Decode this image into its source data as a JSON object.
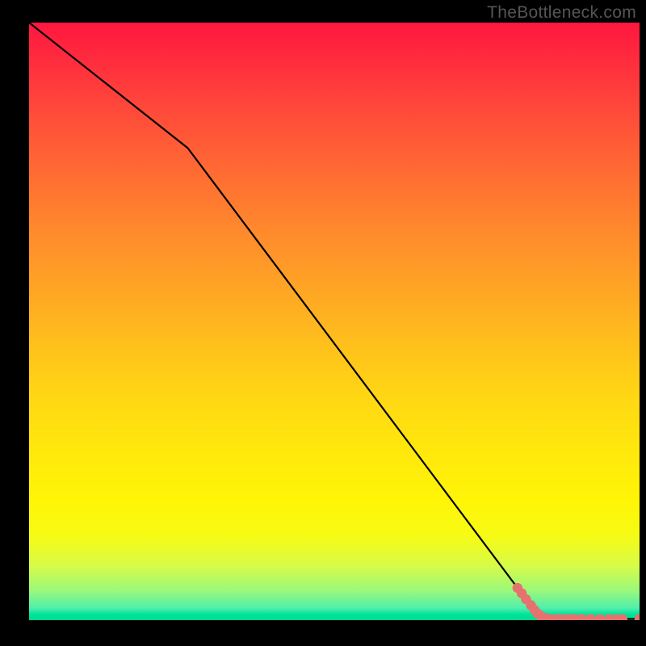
{
  "watermark": "TheBottleneck.com",
  "chart_data": {
    "type": "line",
    "title": "",
    "xlabel": "",
    "ylabel": "",
    "xlim": [
      0,
      100
    ],
    "ylim": [
      0,
      100
    ],
    "line_points": [
      {
        "x": 0,
        "y": 100
      },
      {
        "x": 26,
        "y": 79
      },
      {
        "x": 82.5,
        "y": 2
      },
      {
        "x": 86,
        "y": 0.2
      },
      {
        "x": 100,
        "y": 0.2
      }
    ],
    "marker_points": [
      {
        "x": 80.0,
        "y": 5.4
      },
      {
        "x": 80.7,
        "y": 4.5
      },
      {
        "x": 81.4,
        "y": 3.5
      },
      {
        "x": 82.2,
        "y": 2.5
      },
      {
        "x": 82.8,
        "y": 1.7
      },
      {
        "x": 83.3,
        "y": 1.1
      },
      {
        "x": 83.7,
        "y": 0.8
      },
      {
        "x": 84.2,
        "y": 0.5
      },
      {
        "x": 84.8,
        "y": 0.3
      },
      {
        "x": 85.7,
        "y": 0.2
      },
      {
        "x": 86.7,
        "y": 0.2
      },
      {
        "x": 87.7,
        "y": 0.2
      },
      {
        "x": 88.6,
        "y": 0.2
      },
      {
        "x": 89.5,
        "y": 0.2
      },
      {
        "x": 90.6,
        "y": 0.2
      },
      {
        "x": 92.0,
        "y": 0.2
      },
      {
        "x": 93.5,
        "y": 0.2
      },
      {
        "x": 95.0,
        "y": 0.2
      },
      {
        "x": 96.3,
        "y": 0.2
      },
      {
        "x": 97.2,
        "y": 0.2
      },
      {
        "x": 100.0,
        "y": 0.2
      }
    ],
    "marker_color": "#e5726e",
    "line_color": "#000000"
  }
}
